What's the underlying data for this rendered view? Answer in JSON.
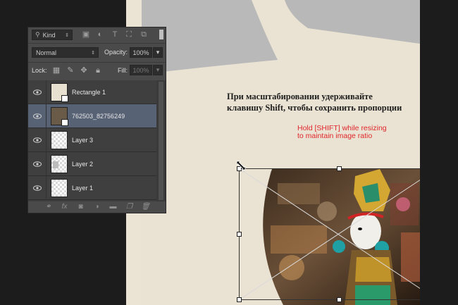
{
  "layers_panel": {
    "filter_kind": "Kind",
    "filter_icons": [
      "image-filter-icon",
      "adjustment-filter-icon",
      "type-filter-icon",
      "shape-filter-icon",
      "smart-object-filter-icon"
    ],
    "blend_mode": "Normal",
    "opacity_label": "Opacity:",
    "opacity_value": "100%",
    "lock_label": "Lock:",
    "lock_icons": [
      "lock-transparent-icon",
      "lock-image-icon",
      "lock-position-icon",
      "lock-all-icon"
    ],
    "fill_label": "Fill:",
    "fill_value": "100%",
    "layers": [
      {
        "name": "Rectangle 1",
        "selected": false,
        "visible": true
      },
      {
        "name": "762503_82756249",
        "selected": true,
        "visible": true
      },
      {
        "name": "Layer 3",
        "selected": false,
        "visible": true
      },
      {
        "name": "Layer 2",
        "selected": false,
        "visible": true
      },
      {
        "name": "Layer 1",
        "selected": false,
        "visible": true
      }
    ],
    "footer_icons": [
      "link-layers-icon",
      "fx-icon",
      "add-mask-icon",
      "adjustment-layer-icon",
      "new-group-icon",
      "new-layer-icon",
      "trash-icon"
    ],
    "fx_text": "fx"
  },
  "canvas": {
    "caption_ru": "При масштабировании удерживайте\nклавишу Shift, чтобы сохранить пропорции",
    "caption_en": "Hold [SHIFT] while resizing\nto maintain image ratio",
    "colors": {
      "cream": "#eae3d3",
      "gray": "#b7b7b7",
      "caption_red": "#e0262a",
      "selected_layer": "#586275"
    }
  }
}
